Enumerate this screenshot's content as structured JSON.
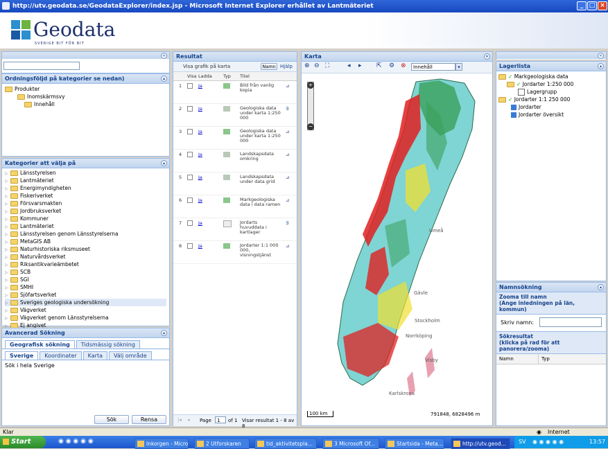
{
  "window": {
    "title": "http://utv.geodata.se/GeodataExplorer/index.jsp - Microsoft Internet Explorer erhållet av Lantmäteriet"
  },
  "header": {
    "brand": "Geodata",
    "tagline": "SVERIGE BIT FÖR BIT"
  },
  "left": {
    "ordning_title": "Ordningsföljd på kategorier se nedan)",
    "tree_top": [
      "Produkter",
      "Inomskärmsvy",
      "Innehåll"
    ],
    "kategorier_title": "Kategorier att välja på",
    "categories": [
      "Länsstyrelsen",
      "Lantmäteriet",
      "Energimyndigheten",
      "Fiskeriverket",
      "Försvarsmakten",
      "Jordbruksverket",
      "Kommuner",
      "Lantmäteriet",
      "Länsstyrelsen genom Länsstyrelserna",
      "MetaGIS AB",
      "Naturhistoriska riksmuseet",
      "Naturvårdsverket",
      "Riksantikvarieämbetet",
      "SCB",
      "SGI",
      "SMHI",
      "Sjöfartsverket",
      "Sveriges geologiska undersökning",
      "Vägverket",
      "Vägverket genom Länsstyrelserna",
      "Ej angivet"
    ],
    "avancerad_title": "Avancerad Sökning",
    "tabs1": [
      "Geografisk sökning",
      "Tidsmässig sökning"
    ],
    "tabs2": [
      "Sverige",
      "Koordinater",
      "Karta",
      "Välj område"
    ],
    "search_text": "Sök i hela Sverige",
    "btn_search": "Sök",
    "btn_clear": "Rensa"
  },
  "result": {
    "title": "Resultat",
    "toolbar_label": "Visa grafik på karta",
    "sort_label": "Namn",
    "help_label": "Hjälp",
    "cols": [
      "Visa",
      "Ladda",
      "Typ",
      "Titel"
    ],
    "rows": [
      {
        "n": "1",
        "dl": "Ja",
        "title": "Bild från vanlig kopia"
      },
      {
        "n": "2",
        "dl": "Ja",
        "title": "Geologiska data under karta 1:250 000"
      },
      {
        "n": "3",
        "dl": "Ja",
        "title": "Geologiska data under karta 1:250 000"
      },
      {
        "n": "4",
        "dl": "Ja",
        "title": "Landskapsdata omkring"
      },
      {
        "n": "5",
        "dl": "Ja",
        "title": "Landskapsdata under data grid"
      },
      {
        "n": "6",
        "dl": "Ja",
        "title": "Markgeologiska data i data ramen"
      },
      {
        "n": "7",
        "dl": "Ja",
        "title": "Jordarts huvuddata i kartlager"
      },
      {
        "n": "8",
        "dl": "Ja",
        "title": "Jordarter 1:1 000 000, visningstjänst"
      }
    ],
    "pager_label": "Page",
    "pager_value": "1",
    "pager_of": "of 1",
    "pager_info": "Visar resultat 1 - 8 av 8"
  },
  "map": {
    "title": "Karta",
    "toolbar_select": "Innehåll",
    "scale": "100 km",
    "coords": "791848, 6828496 m",
    "places": [
      "Gävle",
      "Stockholm",
      "Visby",
      "Karlskrona",
      "Norrköping",
      "Umeå"
    ]
  },
  "right": {
    "lager_title": "Lagerlista",
    "layers": [
      "Markgeologiska data",
      "Jordarter 1:250 000",
      "Lagergrupp",
      "Jordarter 1:1 250 000",
      "Jordarter",
      "Jordarter översikt"
    ],
    "namn_title": "Namnsökning",
    "zoom_title": "Zooma till namn",
    "zoom_sub": "(Ange inledningen på län, kommun)",
    "skriv_label": "Skriv namn:",
    "sok_title": "Sökresultat",
    "sok_sub": "(klicka på rad för att panorera/zooma)",
    "cols": [
      "Namn",
      "Typ"
    ]
  },
  "statusbar": {
    "left": "Klar",
    "zone": "Internet"
  },
  "taskbar": {
    "start": "Start",
    "buttons": [
      "Inkorgen - Micro...",
      "2 Utforskaren",
      "tid_aktivitetspla...",
      "3 Microsoft Of...",
      "Startsida - Meta...",
      "http://utv.geod..."
    ],
    "lang": "SV",
    "clock": "13:57"
  },
  "colors": {
    "accent": "#15428b",
    "map_sea": "#ffffff",
    "map_land": "#7fd4d4",
    "map_red": "#e02020",
    "map_green": "#3aa05a",
    "map_yellow": "#f0e030",
    "taskbar": "#245edb",
    "start": "#3c9a3c"
  }
}
